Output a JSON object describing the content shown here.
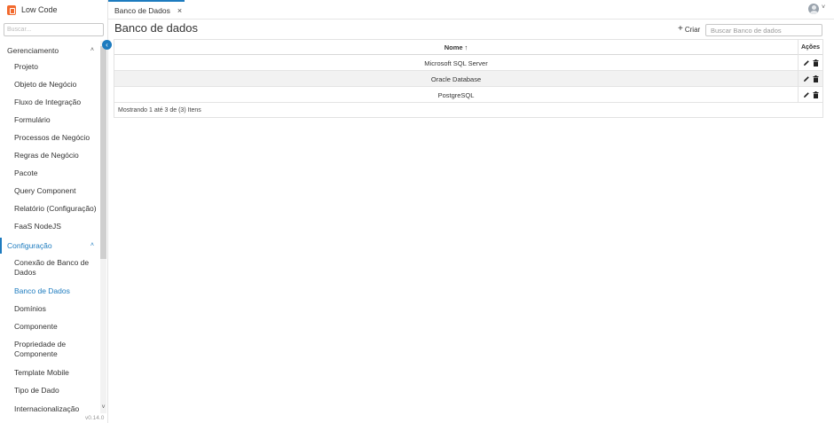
{
  "app": {
    "name": "Low Code",
    "version": "v0.14.0",
    "brand_color": "#f26a2e",
    "accent_color": "#1d7bbf"
  },
  "sidebar": {
    "search_placeholder": "Buscar...",
    "sections": [
      {
        "label": "Gerenciamento",
        "expanded": true,
        "items": [
          "Projeto",
          "Objeto de Negócio",
          "Fluxo de Integração",
          "Formulário",
          "Processos de Negócio",
          "Regras de Negócio",
          "Pacote",
          "Query Component",
          "Relatório (Configuração)",
          "FaaS NodeJS"
        ]
      },
      {
        "label": "Configuração",
        "expanded": true,
        "active": true,
        "items": [
          "Conexão de Banco de Dados",
          "Banco de Dados",
          "Domínios",
          "Componente",
          "Propriedade de Componente",
          "Template Mobile",
          "Tipo de Dado",
          "Internacionalização"
        ],
        "active_item": "Banco de Dados"
      }
    ]
  },
  "tabs": [
    {
      "label": "Banco de Dados",
      "close": "×"
    }
  ],
  "main": {
    "title": "Banco de dados",
    "create_label": "Criar",
    "search_placeholder": "Buscar Banco de dados",
    "grid": {
      "columns": {
        "name": "Nome",
        "sort": "↑",
        "actions": "Ações"
      },
      "rows": [
        {
          "name": "Microsoft SQL Server"
        },
        {
          "name": "Oracle Database"
        },
        {
          "name": "PostgreSQL"
        }
      ],
      "footer": "Mostrando 1 até 3 de (3) Itens"
    }
  }
}
